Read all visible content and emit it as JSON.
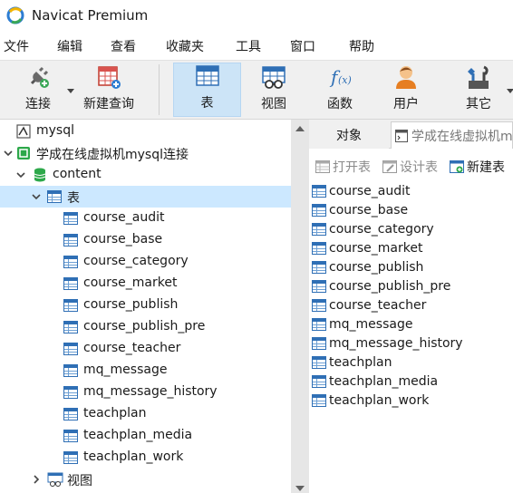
{
  "window": {
    "title": "Navicat Premium"
  },
  "menu": [
    "文件",
    "编辑",
    "查看",
    "收藏夹",
    "工具",
    "窗口",
    "帮助"
  ],
  "toolbar": {
    "connect": "连接",
    "new_query": "新建查询",
    "table": "表",
    "view": "视图",
    "function": "函数",
    "user": "用户",
    "other": "其它"
  },
  "tree": {
    "mysql": "mysql",
    "connection": "学成在线虚拟机mysql连接",
    "database": "content",
    "tables_group": "表",
    "tables": [
      "course_audit",
      "course_base",
      "course_category",
      "course_market",
      "course_publish",
      "course_publish_pre",
      "course_teacher",
      "mq_message",
      "mq_message_history",
      "teachplan",
      "teachplan_media",
      "teachplan_work"
    ],
    "views_group": "视图"
  },
  "right": {
    "tab_objects": "对象",
    "tab_query": "学成在线虚拟机m",
    "btn_open": "打开表",
    "btn_design": "设计表",
    "btn_new": "新建表",
    "objects": [
      "course_audit",
      "course_base",
      "course_category",
      "course_market",
      "course_publish",
      "course_publish_pre",
      "course_teacher",
      "mq_message",
      "mq_message_history",
      "teachplan",
      "teachplan_media",
      "teachplan_work"
    ]
  }
}
